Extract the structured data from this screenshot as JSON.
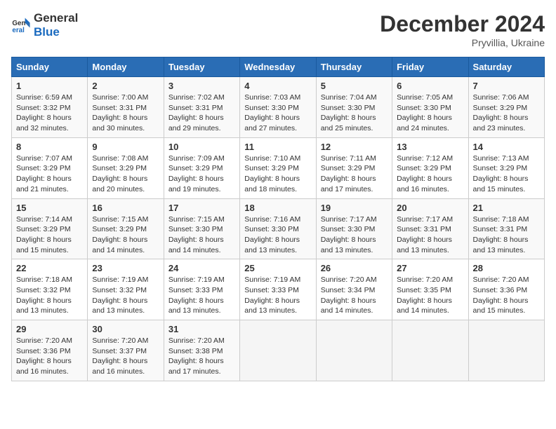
{
  "header": {
    "logo_general": "General",
    "logo_blue": "Blue",
    "title": "December 2024",
    "subtitle": "Pryvillia, Ukraine"
  },
  "weekdays": [
    "Sunday",
    "Monday",
    "Tuesday",
    "Wednesday",
    "Thursday",
    "Friday",
    "Saturday"
  ],
  "weeks": [
    [
      {
        "day": "1",
        "lines": [
          "Sunrise: 6:59 AM",
          "Sunset: 3:32 PM",
          "Daylight: 8 hours",
          "and 32 minutes."
        ]
      },
      {
        "day": "2",
        "lines": [
          "Sunrise: 7:00 AM",
          "Sunset: 3:31 PM",
          "Daylight: 8 hours",
          "and 30 minutes."
        ]
      },
      {
        "day": "3",
        "lines": [
          "Sunrise: 7:02 AM",
          "Sunset: 3:31 PM",
          "Daylight: 8 hours",
          "and 29 minutes."
        ]
      },
      {
        "day": "4",
        "lines": [
          "Sunrise: 7:03 AM",
          "Sunset: 3:30 PM",
          "Daylight: 8 hours",
          "and 27 minutes."
        ]
      },
      {
        "day": "5",
        "lines": [
          "Sunrise: 7:04 AM",
          "Sunset: 3:30 PM",
          "Daylight: 8 hours",
          "and 25 minutes."
        ]
      },
      {
        "day": "6",
        "lines": [
          "Sunrise: 7:05 AM",
          "Sunset: 3:30 PM",
          "Daylight: 8 hours",
          "and 24 minutes."
        ]
      },
      {
        "day": "7",
        "lines": [
          "Sunrise: 7:06 AM",
          "Sunset: 3:29 PM",
          "Daylight: 8 hours",
          "and 23 minutes."
        ]
      }
    ],
    [
      {
        "day": "8",
        "lines": [
          "Sunrise: 7:07 AM",
          "Sunset: 3:29 PM",
          "Daylight: 8 hours",
          "and 21 minutes."
        ]
      },
      {
        "day": "9",
        "lines": [
          "Sunrise: 7:08 AM",
          "Sunset: 3:29 PM",
          "Daylight: 8 hours",
          "and 20 minutes."
        ]
      },
      {
        "day": "10",
        "lines": [
          "Sunrise: 7:09 AM",
          "Sunset: 3:29 PM",
          "Daylight: 8 hours",
          "and 19 minutes."
        ]
      },
      {
        "day": "11",
        "lines": [
          "Sunrise: 7:10 AM",
          "Sunset: 3:29 PM",
          "Daylight: 8 hours",
          "and 18 minutes."
        ]
      },
      {
        "day": "12",
        "lines": [
          "Sunrise: 7:11 AM",
          "Sunset: 3:29 PM",
          "Daylight: 8 hours",
          "and 17 minutes."
        ]
      },
      {
        "day": "13",
        "lines": [
          "Sunrise: 7:12 AM",
          "Sunset: 3:29 PM",
          "Daylight: 8 hours",
          "and 16 minutes."
        ]
      },
      {
        "day": "14",
        "lines": [
          "Sunrise: 7:13 AM",
          "Sunset: 3:29 PM",
          "Daylight: 8 hours",
          "and 15 minutes."
        ]
      }
    ],
    [
      {
        "day": "15",
        "lines": [
          "Sunrise: 7:14 AM",
          "Sunset: 3:29 PM",
          "Daylight: 8 hours",
          "and 15 minutes."
        ]
      },
      {
        "day": "16",
        "lines": [
          "Sunrise: 7:15 AM",
          "Sunset: 3:29 PM",
          "Daylight: 8 hours",
          "and 14 minutes."
        ]
      },
      {
        "day": "17",
        "lines": [
          "Sunrise: 7:15 AM",
          "Sunset: 3:30 PM",
          "Daylight: 8 hours",
          "and 14 minutes."
        ]
      },
      {
        "day": "18",
        "lines": [
          "Sunrise: 7:16 AM",
          "Sunset: 3:30 PM",
          "Daylight: 8 hours",
          "and 13 minutes."
        ]
      },
      {
        "day": "19",
        "lines": [
          "Sunrise: 7:17 AM",
          "Sunset: 3:30 PM",
          "Daylight: 8 hours",
          "and 13 minutes."
        ]
      },
      {
        "day": "20",
        "lines": [
          "Sunrise: 7:17 AM",
          "Sunset: 3:31 PM",
          "Daylight: 8 hours",
          "and 13 minutes."
        ]
      },
      {
        "day": "21",
        "lines": [
          "Sunrise: 7:18 AM",
          "Sunset: 3:31 PM",
          "Daylight: 8 hours",
          "and 13 minutes."
        ]
      }
    ],
    [
      {
        "day": "22",
        "lines": [
          "Sunrise: 7:18 AM",
          "Sunset: 3:32 PM",
          "Daylight: 8 hours",
          "and 13 minutes."
        ]
      },
      {
        "day": "23",
        "lines": [
          "Sunrise: 7:19 AM",
          "Sunset: 3:32 PM",
          "Daylight: 8 hours",
          "and 13 minutes."
        ]
      },
      {
        "day": "24",
        "lines": [
          "Sunrise: 7:19 AM",
          "Sunset: 3:33 PM",
          "Daylight: 8 hours",
          "and 13 minutes."
        ]
      },
      {
        "day": "25",
        "lines": [
          "Sunrise: 7:19 AM",
          "Sunset: 3:33 PM",
          "Daylight: 8 hours",
          "and 13 minutes."
        ]
      },
      {
        "day": "26",
        "lines": [
          "Sunrise: 7:20 AM",
          "Sunset: 3:34 PM",
          "Daylight: 8 hours",
          "and 14 minutes."
        ]
      },
      {
        "day": "27",
        "lines": [
          "Sunrise: 7:20 AM",
          "Sunset: 3:35 PM",
          "Daylight: 8 hours",
          "and 14 minutes."
        ]
      },
      {
        "day": "28",
        "lines": [
          "Sunrise: 7:20 AM",
          "Sunset: 3:36 PM",
          "Daylight: 8 hours",
          "and 15 minutes."
        ]
      }
    ],
    [
      {
        "day": "29",
        "lines": [
          "Sunrise: 7:20 AM",
          "Sunset: 3:36 PM",
          "Daylight: 8 hours",
          "and 16 minutes."
        ]
      },
      {
        "day": "30",
        "lines": [
          "Sunrise: 7:20 AM",
          "Sunset: 3:37 PM",
          "Daylight: 8 hours",
          "and 16 minutes."
        ]
      },
      {
        "day": "31",
        "lines": [
          "Sunrise: 7:20 AM",
          "Sunset: 3:38 PM",
          "Daylight: 8 hours",
          "and 17 minutes."
        ]
      },
      null,
      null,
      null,
      null
    ]
  ]
}
